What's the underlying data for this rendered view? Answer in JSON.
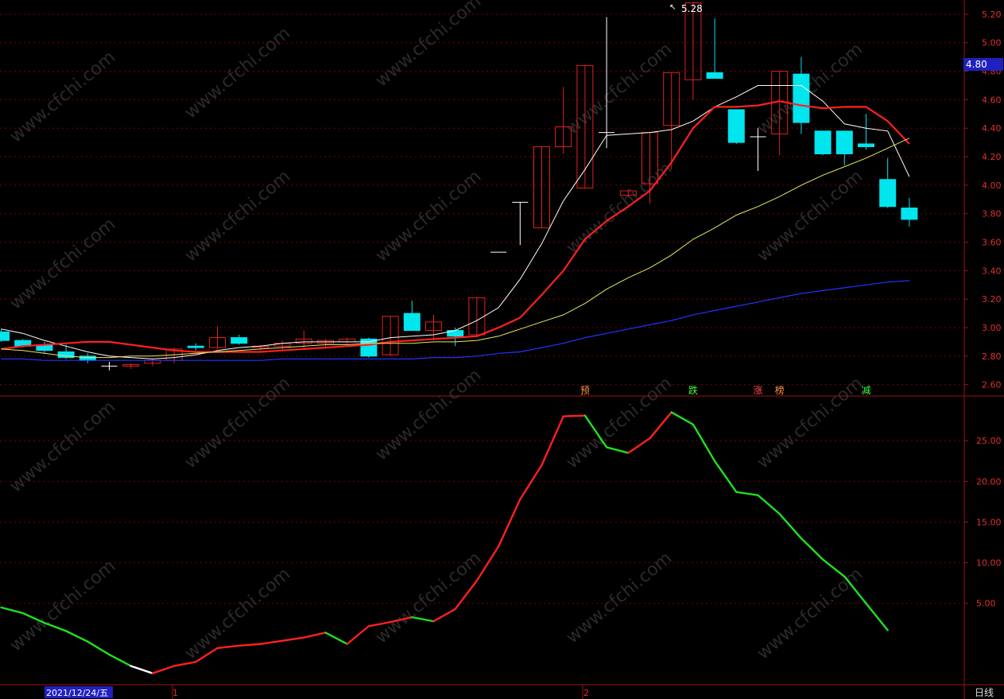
{
  "watermark": "www.cfchi.com",
  "price_label": "4.80",
  "peak_label": "5.28",
  "period_label": "日线",
  "date_label": "2021/12/24/五",
  "month_marks": [
    "1",
    "2"
  ],
  "colors": {
    "up": "#e02020",
    "down": "#00e5ee",
    "ma5": "#ffffff",
    "ma10": "#ff2020",
    "ma20": "#e8e860",
    "ma60": "#2233ff",
    "grid": "#7a0000",
    "axis": "#a01010",
    "ind_up": "#ff2020",
    "ind_down": "#20e020",
    "ind_flat": "#ffffff",
    "badge_bg": "#2020c0"
  },
  "signals": [
    {
      "text": "预",
      "color": "#ff9040",
      "bar": 27
    },
    {
      "text": "跌",
      "color": "#40ff40",
      "bar": 32
    },
    {
      "text": "涨",
      "color": "#ff5050",
      "bar": 35
    },
    {
      "text": "榜",
      "color": "#ff9040",
      "bar": 36
    },
    {
      "text": "减",
      "color": "#40ff40",
      "bar": 40
    }
  ],
  "chart_data": [
    {
      "type": "candlestick",
      "title": "",
      "ylim": [
        2.52,
        5.3
      ],
      "yticks": [
        "5.20",
        "5.00",
        "4.80",
        "4.60",
        "4.40",
        "4.20",
        "4.00",
        "3.80",
        "3.60",
        "3.40",
        "3.20",
        "3.00",
        "2.80",
        "2.60"
      ],
      "candles": [
        {
          "o": 2.97,
          "h": 2.99,
          "l": 2.9,
          "c": 2.91
        },
        {
          "o": 2.91,
          "h": 2.92,
          "l": 2.86,
          "c": 2.87
        },
        {
          "o": 2.88,
          "h": 2.9,
          "l": 2.82,
          "c": 2.84
        },
        {
          "o": 2.83,
          "h": 2.88,
          "l": 2.78,
          "c": 2.79
        },
        {
          "o": 2.8,
          "h": 2.82,
          "l": 2.75,
          "c": 2.77
        },
        {
          "o": 2.73,
          "h": 2.76,
          "l": 2.7,
          "c": 2.73
        },
        {
          "o": 2.73,
          "h": 2.75,
          "l": 2.71,
          "c": 2.74
        },
        {
          "o": 2.75,
          "h": 2.78,
          "l": 2.73,
          "c": 2.77
        },
        {
          "o": 2.77,
          "h": 2.86,
          "l": 2.75,
          "c": 2.85
        },
        {
          "o": 2.87,
          "h": 2.89,
          "l": 2.84,
          "c": 2.86
        },
        {
          "o": 2.86,
          "h": 3.01,
          "l": 2.85,
          "c": 2.93
        },
        {
          "o": 2.93,
          "h": 2.95,
          "l": 2.88,
          "c": 2.89
        },
        {
          "o": 2.86,
          "h": 2.88,
          "l": 2.84,
          "c": 2.87
        },
        {
          "o": 2.87,
          "h": 2.91,
          "l": 2.84,
          "c": 2.89
        },
        {
          "o": 2.89,
          "h": 2.98,
          "l": 2.86,
          "c": 2.92
        },
        {
          "o": 2.89,
          "h": 2.92,
          "l": 2.86,
          "c": 2.91
        },
        {
          "o": 2.9,
          "h": 2.93,
          "l": 2.88,
          "c": 2.92
        },
        {
          "o": 2.92,
          "h": 2.93,
          "l": 2.79,
          "c": 2.8
        },
        {
          "o": 2.81,
          "h": 3.08,
          "l": 2.8,
          "c": 3.08
        },
        {
          "o": 3.1,
          "h": 3.19,
          "l": 2.98,
          "c": 2.98
        },
        {
          "o": 2.98,
          "h": 3.09,
          "l": 2.91,
          "c": 3.04
        },
        {
          "o": 2.98,
          "h": 3.0,
          "l": 2.87,
          "c": 2.94
        },
        {
          "o": 2.95,
          "h": 3.21,
          "l": 2.94,
          "c": 3.21
        },
        {
          "o": 3.53,
          "h": 3.53,
          "l": 3.53,
          "c": 3.53
        },
        {
          "o": 3.88,
          "h": 3.88,
          "l": 3.58,
          "c": 3.88
        },
        {
          "o": 3.7,
          "h": 4.27,
          "l": 3.7,
          "c": 4.27
        },
        {
          "o": 4.27,
          "h": 4.69,
          "l": 4.22,
          "c": 4.41
        },
        {
          "o": 3.98,
          "h": 4.84,
          "l": 3.98,
          "c": 4.84
        },
        {
          "o": 4.37,
          "h": 5.18,
          "l": 4.26,
          "c": 4.37
        },
        {
          "o": 3.93,
          "h": 3.97,
          "l": 3.92,
          "c": 3.96
        },
        {
          "o": 4.01,
          "h": 4.37,
          "l": 3.87,
          "c": 4.37
        },
        {
          "o": 4.42,
          "h": 4.79,
          "l": 4.11,
          "c": 4.79
        },
        {
          "o": 4.74,
          "h": 5.28,
          "l": 4.6,
          "c": 5.28
        },
        {
          "o": 4.79,
          "h": 5.17,
          "l": 4.75,
          "c": 4.75
        },
        {
          "o": 4.53,
          "h": 4.53,
          "l": 4.29,
          "c": 4.3
        },
        {
          "o": 4.34,
          "h": 4.4,
          "l": 4.1,
          "c": 4.34
        },
        {
          "o": 4.36,
          "h": 4.8,
          "l": 4.21,
          "c": 4.8
        },
        {
          "o": 4.78,
          "h": 4.9,
          "l": 4.36,
          "c": 4.44
        },
        {
          "o": 4.38,
          "h": 4.38,
          "l": 4.21,
          "c": 4.22
        },
        {
          "o": 4.38,
          "h": 4.38,
          "l": 4.14,
          "c": 4.22
        },
        {
          "o": 4.29,
          "h": 4.5,
          "l": 4.25,
          "c": 4.27
        },
        {
          "o": 4.04,
          "h": 4.19,
          "l": 3.84,
          "c": 3.85
        },
        {
          "o": 3.84,
          "h": 3.91,
          "l": 3.71,
          "c": 3.76
        }
      ],
      "series": [
        {
          "key": "ma5",
          "values": [
            2.99,
            2.96,
            2.91,
            2.87,
            2.83,
            2.8,
            2.79,
            2.78,
            2.79,
            2.81,
            2.84,
            2.86,
            2.87,
            2.89,
            2.9,
            2.9,
            2.9,
            2.9,
            2.93,
            2.94,
            2.95,
            2.98,
            3.05,
            3.14,
            3.34,
            3.59,
            3.89,
            4.11,
            4.35,
            4.36,
            4.37,
            4.39,
            4.45,
            4.55,
            4.62,
            4.7,
            4.7,
            4.7,
            4.59,
            4.43,
            4.4,
            4.38,
            4.06
          ]
        },
        {
          "key": "ma10",
          "values": [
            2.85,
            2.87,
            2.88,
            2.89,
            2.9,
            2.9,
            2.88,
            2.86,
            2.84,
            2.83,
            2.83,
            2.83,
            2.83,
            2.84,
            2.85,
            2.86,
            2.87,
            2.88,
            2.9,
            2.91,
            2.92,
            2.93,
            2.94,
            3.0,
            3.07,
            3.23,
            3.4,
            3.62,
            3.75,
            3.85,
            3.96,
            4.16,
            4.4,
            4.55,
            4.55,
            4.56,
            4.59,
            4.56,
            4.54,
            4.55,
            4.55,
            4.45,
            4.29
          ]
        },
        {
          "key": "ma20",
          "values": [
            2.85,
            2.84,
            2.82,
            2.8,
            2.79,
            2.79,
            2.8,
            2.8,
            2.81,
            2.82,
            2.83,
            2.84,
            2.85,
            2.86,
            2.87,
            2.88,
            2.88,
            2.89,
            2.89,
            2.89,
            2.9,
            2.9,
            2.91,
            2.94,
            2.99,
            3.04,
            3.09,
            3.17,
            3.27,
            3.35,
            3.42,
            3.51,
            3.62,
            3.7,
            3.79,
            3.85,
            3.92,
            4.0,
            4.07,
            4.13,
            4.19,
            4.26,
            4.33
          ]
        },
        {
          "key": "ma60",
          "values": [
            2.78,
            2.78,
            2.77,
            2.77,
            2.77,
            2.77,
            2.77,
            2.77,
            2.77,
            2.77,
            2.77,
            2.77,
            2.77,
            2.78,
            2.78,
            2.78,
            2.78,
            2.78,
            2.78,
            2.78,
            2.79,
            2.79,
            2.8,
            2.82,
            2.83,
            2.86,
            2.89,
            2.93,
            2.96,
            2.99,
            3.02,
            3.05,
            3.09,
            3.12,
            3.15,
            3.18,
            3.21,
            3.24,
            3.26,
            3.28,
            3.3,
            3.32,
            3.33
          ]
        }
      ]
    },
    {
      "type": "line",
      "title": "",
      "ylim": [
        -5.0,
        30.5
      ],
      "yticks": [
        "25.00",
        "20.00",
        "15.00",
        "10.00",
        "5.00"
      ],
      "series": [
        {
          "key": "indicator",
          "values": [
            4.5,
            3.8,
            2.6,
            1.6,
            0.3,
            -1.3,
            -2.7,
            -3.6,
            -2.7,
            -2.2,
            -0.5,
            -0.2,
            0.0,
            0.4,
            0.8,
            1.4,
            0.0,
            2.2,
            2.7,
            3.3,
            2.8,
            4.3,
            7.8,
            12.0,
            17.8,
            22.0,
            28.0,
            28.1,
            24.2,
            23.5,
            25.3,
            28.5,
            27.0,
            22.5,
            18.7,
            18.3,
            16.0,
            13.0,
            10.4,
            8.3,
            5.0,
            1.7
          ]
        }
      ]
    }
  ]
}
